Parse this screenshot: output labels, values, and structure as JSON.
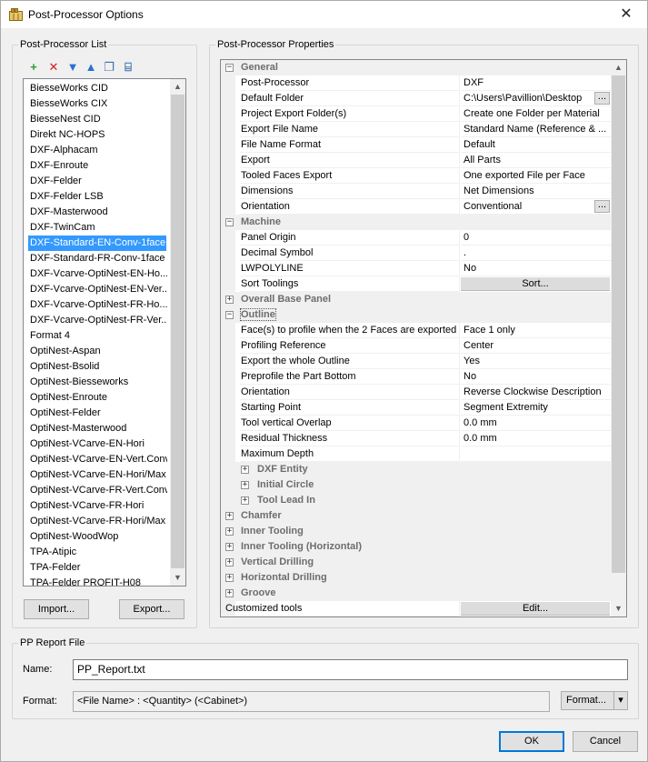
{
  "window": {
    "title": "Post-Processor Options",
    "icon": "app-icon",
    "close_glyph": "✕"
  },
  "left_group": {
    "legend": "Post-Processor List",
    "toolbar": [
      {
        "name": "add-icon",
        "glyph": "+",
        "color": "#2e9e2e"
      },
      {
        "name": "delete-icon",
        "glyph": "✕",
        "color": "#d42020"
      },
      {
        "name": "move-down-icon",
        "glyph": "▼",
        "color": "#2c6fd8"
      },
      {
        "name": "move-up-icon",
        "glyph": "▲",
        "color": "#2c6fd8"
      },
      {
        "name": "copy-icon",
        "glyph": "❐",
        "color": "#3a6fb0"
      },
      {
        "name": "rename-icon",
        "glyph": "⌸",
        "color": "#3a6fb0"
      }
    ],
    "items": [
      "BiesseWorks CID",
      "BiesseWorks CIX",
      "BiesseNest CID",
      "Direkt NC-HOPS",
      "DXF-Alphacam",
      "DXF-Enroute",
      "DXF-Felder",
      "DXF-Felder LSB",
      "DXF-Masterwood",
      "DXF-TwinCam",
      "DXF-Standard-EN-Conv-1face",
      "DXF-Standard-FR-Conv-1face",
      "DXF-Vcarve-OptiNest-EN-Ho...",
      "DXF-Vcarve-OptiNest-EN-Ver...",
      "DXF-Vcarve-OptiNest-FR-Ho...",
      "DXF-Vcarve-OptiNest-FR-Ver...",
      "Format 4",
      "OptiNest-Aspan",
      "OptiNest-Bsolid",
      "OptiNest-Biesseworks",
      "OptiNest-Enroute",
      "OptiNest-Felder",
      "OptiNest-Masterwood",
      "OptiNest-VCarve-EN-Hori",
      "OptiNest-VCarve-EN-Vert.Conv",
      "OptiNest-VCarve-EN-Hori/Max",
      "OptiNest-VCarve-FR-Vert.Conv",
      "OptiNest-VCarve-FR-Hori",
      "OptiNest-VCarve-FR-Hori/Max",
      "OptiNest-WoodWop",
      "TPA-Atipic",
      "TPA-Felder",
      "TPA-Felder PROFIT-H08"
    ],
    "selected_index": 10,
    "import_label": "Import...",
    "export_label": "Export..."
  },
  "right_group": {
    "legend": "Post-Processor Properties",
    "rows": [
      {
        "type": "cat",
        "label": "General",
        "expanded": true,
        "indent": 0
      },
      {
        "type": "prop",
        "name": "Post-Processor",
        "value": "DXF"
      },
      {
        "type": "prop",
        "name": "Default Folder",
        "value": "C:\\Users\\Pavillion\\Desktop",
        "ellipsis": true
      },
      {
        "type": "prop",
        "name": "Project Export Folder(s)",
        "value": "Create one Folder per Material"
      },
      {
        "type": "prop",
        "name": "Export File Name",
        "value": "Standard Name (Reference & ..."
      },
      {
        "type": "prop",
        "name": "File Name Format",
        "value": "Default"
      },
      {
        "type": "prop",
        "name": "Export",
        "value": "All Parts"
      },
      {
        "type": "prop",
        "name": "Tooled Faces Export",
        "value": "One exported File per Face"
      },
      {
        "type": "prop",
        "name": "Dimensions",
        "value": "Net Dimensions"
      },
      {
        "type": "prop",
        "name": "Orientation",
        "value": "Conventional",
        "ellipsis": true
      },
      {
        "type": "cat",
        "label": "Machine",
        "expanded": true,
        "indent": 0
      },
      {
        "type": "prop",
        "name": "Panel Origin",
        "value": "0"
      },
      {
        "type": "prop",
        "name": "Decimal Symbol",
        "value": "."
      },
      {
        "type": "prop",
        "name": "LWPOLYLINE",
        "value": "No"
      },
      {
        "type": "prop",
        "name": "Sort Toolings",
        "button": "Sort..."
      },
      {
        "type": "cat",
        "label": "Overall Base Panel",
        "expanded": false,
        "indent": 0
      },
      {
        "type": "cat",
        "label": "Outline",
        "expanded": true,
        "indent": 0,
        "focused": true
      },
      {
        "type": "prop",
        "name": "Face(s) to profile when the 2 Faces are exported",
        "value": "Face 1 only"
      },
      {
        "type": "prop",
        "name": "Profiling Reference",
        "value": "Center"
      },
      {
        "type": "prop",
        "name": "Export the whole Outline",
        "value": "Yes"
      },
      {
        "type": "prop",
        "name": "Preprofile the Part Bottom",
        "value": "No"
      },
      {
        "type": "prop",
        "name": "Orientation",
        "value": "Reverse Clockwise Description"
      },
      {
        "type": "prop",
        "name": "Starting Point",
        "value": "Segment Extremity"
      },
      {
        "type": "prop",
        "name": "Tool vertical Overlap",
        "value": "0.0 mm"
      },
      {
        "type": "prop",
        "name": "Residual Thickness",
        "value": "0.0 mm"
      },
      {
        "type": "prop",
        "name": "Maximum Depth",
        "value": ""
      },
      {
        "type": "cat",
        "label": "DXF Entity",
        "expanded": false,
        "indent": 1
      },
      {
        "type": "cat",
        "label": "Initial Circle",
        "expanded": false,
        "indent": 1
      },
      {
        "type": "cat",
        "label": "Tool Lead In",
        "expanded": false,
        "indent": 1
      },
      {
        "type": "cat",
        "label": "Chamfer",
        "expanded": false,
        "indent": 0
      },
      {
        "type": "cat",
        "label": "Inner Tooling",
        "expanded": false,
        "indent": 0
      },
      {
        "type": "cat",
        "label": "Inner Tooling (Horizontal)",
        "expanded": false,
        "indent": 0
      },
      {
        "type": "cat",
        "label": "Vertical Drilling",
        "expanded": false,
        "indent": 0
      },
      {
        "type": "cat",
        "label": "Horizontal Drilling",
        "expanded": false,
        "indent": 0
      },
      {
        "type": "cat",
        "label": "Groove",
        "expanded": false,
        "indent": 0
      },
      {
        "type": "root",
        "name": "Customized tools",
        "button": "Edit..."
      }
    ]
  },
  "report": {
    "legend": "PP Report File",
    "name_label": "Name:",
    "name_value": "PP_Report.txt",
    "format_label": "Format:",
    "format_value": "<File Name> : <Quantity> (<Cabinet>)",
    "format_button": "Format...",
    "format_dropdown": "▾"
  },
  "footer": {
    "ok": "OK",
    "cancel": "Cancel"
  }
}
